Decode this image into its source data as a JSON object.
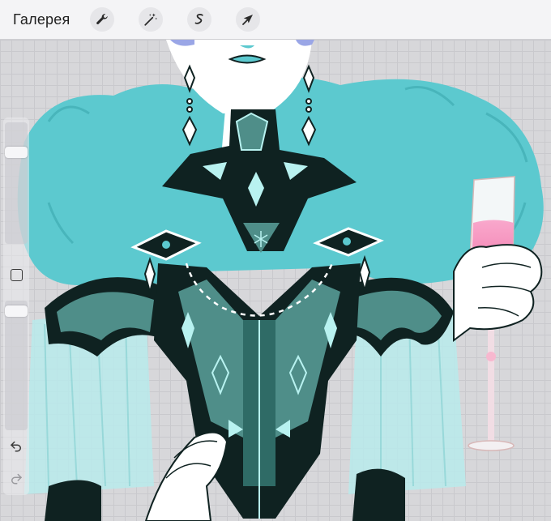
{
  "toolbar": {
    "gallery_label": "Галерея",
    "tools": [
      {
        "name": "wrench-icon"
      },
      {
        "name": "magic-wand-icon"
      },
      {
        "name": "selection-s-icon"
      },
      {
        "name": "arrow-cursor-icon"
      }
    ]
  },
  "sidebar": {
    "brush_size_slider": {
      "level": 0.85
    },
    "opacity_slider": {
      "level": 0.95
    },
    "icons": [
      "modify-square-icon",
      "undo-icon",
      "redo-icon"
    ]
  },
  "colors": {
    "toolbar_bg": "#f4f4f6",
    "canvas_grid": "#d7d7da",
    "fur": "#5cc9cf",
    "dark_teal": "#0f2221",
    "mid_teal": "#4f8e89",
    "wine_pink": "#f58db7"
  }
}
